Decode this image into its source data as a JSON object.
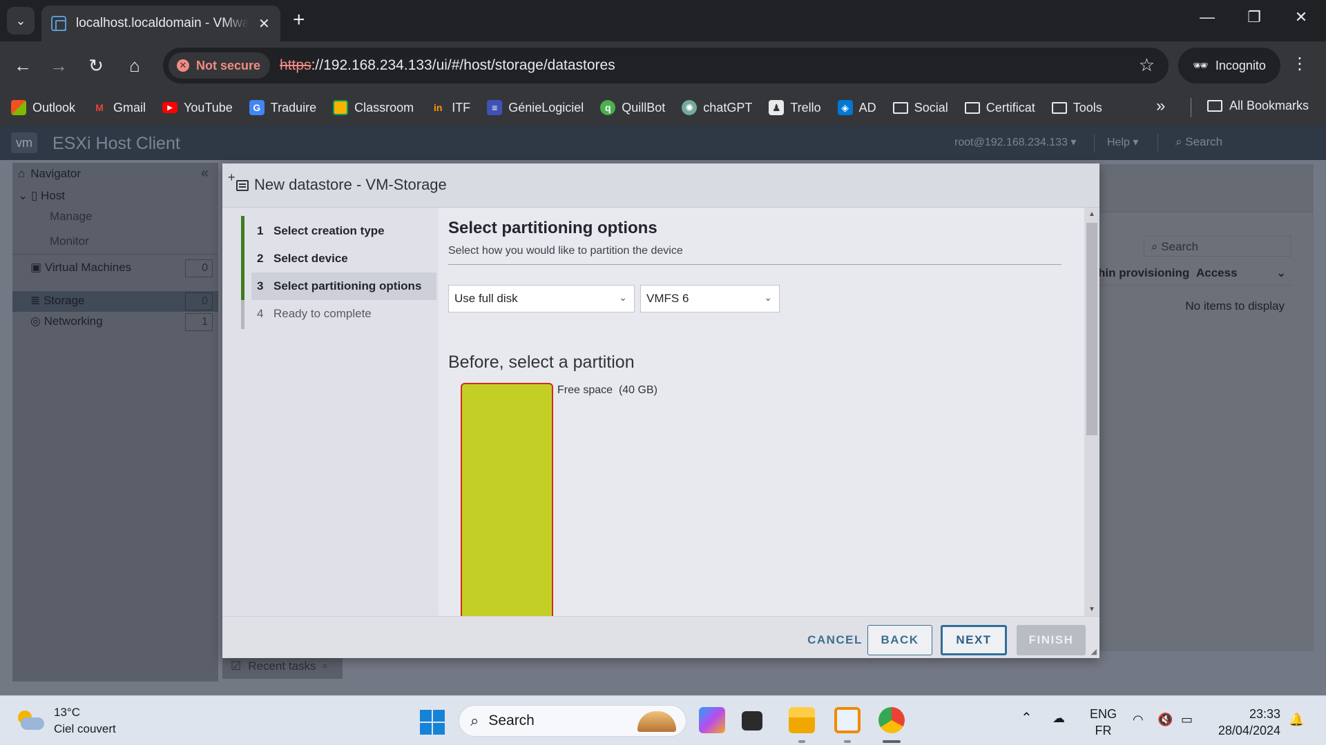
{
  "browser": {
    "tab_title": "localhost.localdomain - VMware ESXi",
    "security_chip": "Not secure",
    "url_scheme": "https",
    "url_rest": "://192.168.234.133/ui/#/host/storage/datastores",
    "incognito_label": "Incognito",
    "bookmarks": [
      {
        "label": "Outlook",
        "icon": "outlook-icon",
        "color": "#f25022"
      },
      {
        "label": "Gmail",
        "icon": "gmail-icon",
        "color": "#ea4335"
      },
      {
        "label": "YouTube",
        "icon": "youtube-icon",
        "color": "#ff0000"
      },
      {
        "label": "Traduire",
        "icon": "translate-icon",
        "color": "#4285f4"
      },
      {
        "label": "Classroom",
        "icon": "classroom-icon",
        "color": "#f4b400"
      },
      {
        "label": "ITF",
        "icon": "itf-icon",
        "color": "#ff9800"
      },
      {
        "label": "GénieLogiciel",
        "icon": "forms-icon",
        "color": "#3f51b5"
      },
      {
        "label": "QuillBot",
        "icon": "quillbot-icon",
        "color": "#4caf50"
      },
      {
        "label": "chatGPT",
        "icon": "chatgpt-icon",
        "color": "#74aa9c"
      },
      {
        "label": "Trello",
        "icon": "trello-icon",
        "color": "#333333"
      },
      {
        "label": "AD",
        "icon": "ad-icon",
        "color": "#0078d4"
      },
      {
        "label": "Social",
        "icon": "folder-icon",
        "color": ""
      },
      {
        "label": "Certificat",
        "icon": "folder-icon",
        "color": ""
      },
      {
        "label": "Tools",
        "icon": "folder-icon",
        "color": ""
      }
    ],
    "more_bookmarks": "»",
    "all_bookmarks": "All Bookmarks"
  },
  "esxi": {
    "logo": "vm",
    "title": "ESXi Host Client",
    "user": "root@192.168.234.133 ▾",
    "help": "Help ▾",
    "search": "Search",
    "navigator": {
      "title": "Navigator",
      "host": "Host",
      "manage": "Manage",
      "monitor": "Monitor",
      "virtual_machines": "Virtual Machines",
      "virtual_machines_count": "0",
      "storage": "Storage",
      "storage_count": "0",
      "networking": "Networking",
      "networking_count": "1"
    },
    "content": {
      "search_placeholder": "Search",
      "col_provisioning": "hin provisioning",
      "col_access": "Access",
      "empty": "No items to display"
    },
    "recent_tasks": "Recent tasks"
  },
  "modal": {
    "title": "New datastore - VM-Storage",
    "steps": [
      {
        "num": "1",
        "label": "Select creation type"
      },
      {
        "num": "2",
        "label": "Select device"
      },
      {
        "num": "3",
        "label": "Select partitioning options"
      },
      {
        "num": "4",
        "label": "Ready to complete"
      }
    ],
    "heading": "Select partitioning options",
    "subheading": "Select how you would like to partition the device",
    "partition_select": "Use full disk",
    "vmfs_select": "VMFS 6",
    "before_title": "Before, select a partition",
    "partition_label": "Free space",
    "partition_size": "(40 GB)",
    "buttons": {
      "cancel": "CANCEL",
      "back": "BACK",
      "next": "NEXT",
      "finish": "FINISH"
    }
  },
  "taskbar": {
    "temperature": "13°C",
    "weather": "Ciel couvert",
    "search": "Search",
    "lang": "ENG",
    "region": "FR",
    "time": "23:33",
    "date": "28/04/2024"
  }
}
